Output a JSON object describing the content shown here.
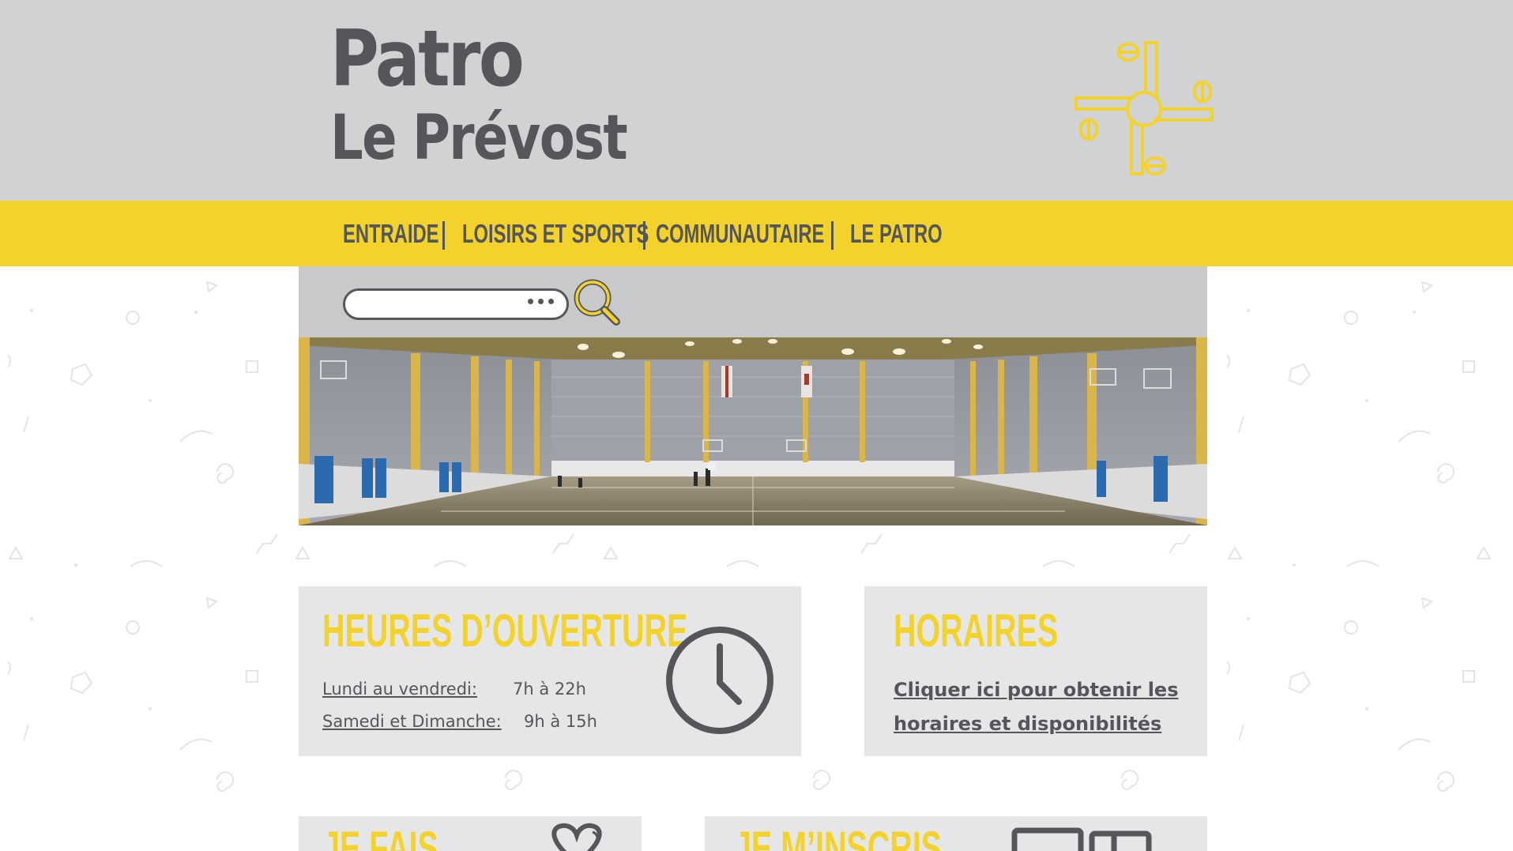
{
  "site": {
    "name_line1": "Patro",
    "name_line2": "Le Prévost"
  },
  "nav": {
    "items": [
      {
        "label": "ENTRAIDE"
      },
      {
        "label": "LOISIRS ET SPORTS"
      },
      {
        "label": "COMMUNAUTAIRE"
      },
      {
        "label": "LE PATRO"
      }
    ]
  },
  "search": {
    "placeholder": ""
  },
  "opening_hours": {
    "title": "HEURES D’OUVERTURE",
    "rows": [
      {
        "days": "Lundi au vendredi:",
        "hours": "7h à 22h"
      },
      {
        "days": "Samedi et Dimanche:",
        "hours": "9h à 15h"
      }
    ]
  },
  "schedules": {
    "title": "HORAIRES",
    "link": "Cliquer ici pour obtenir les horaires et disponibilités"
  },
  "bottom_cards": [
    {
      "title": "JE FAIS"
    },
    {
      "title": "JE M’INSCRIS"
    }
  ],
  "colors": {
    "brand_yellow": "#f4d22c",
    "brand_gray": "#55565a",
    "header_bg": "#d1d2d4",
    "card_bg": "#e5e6e7"
  }
}
